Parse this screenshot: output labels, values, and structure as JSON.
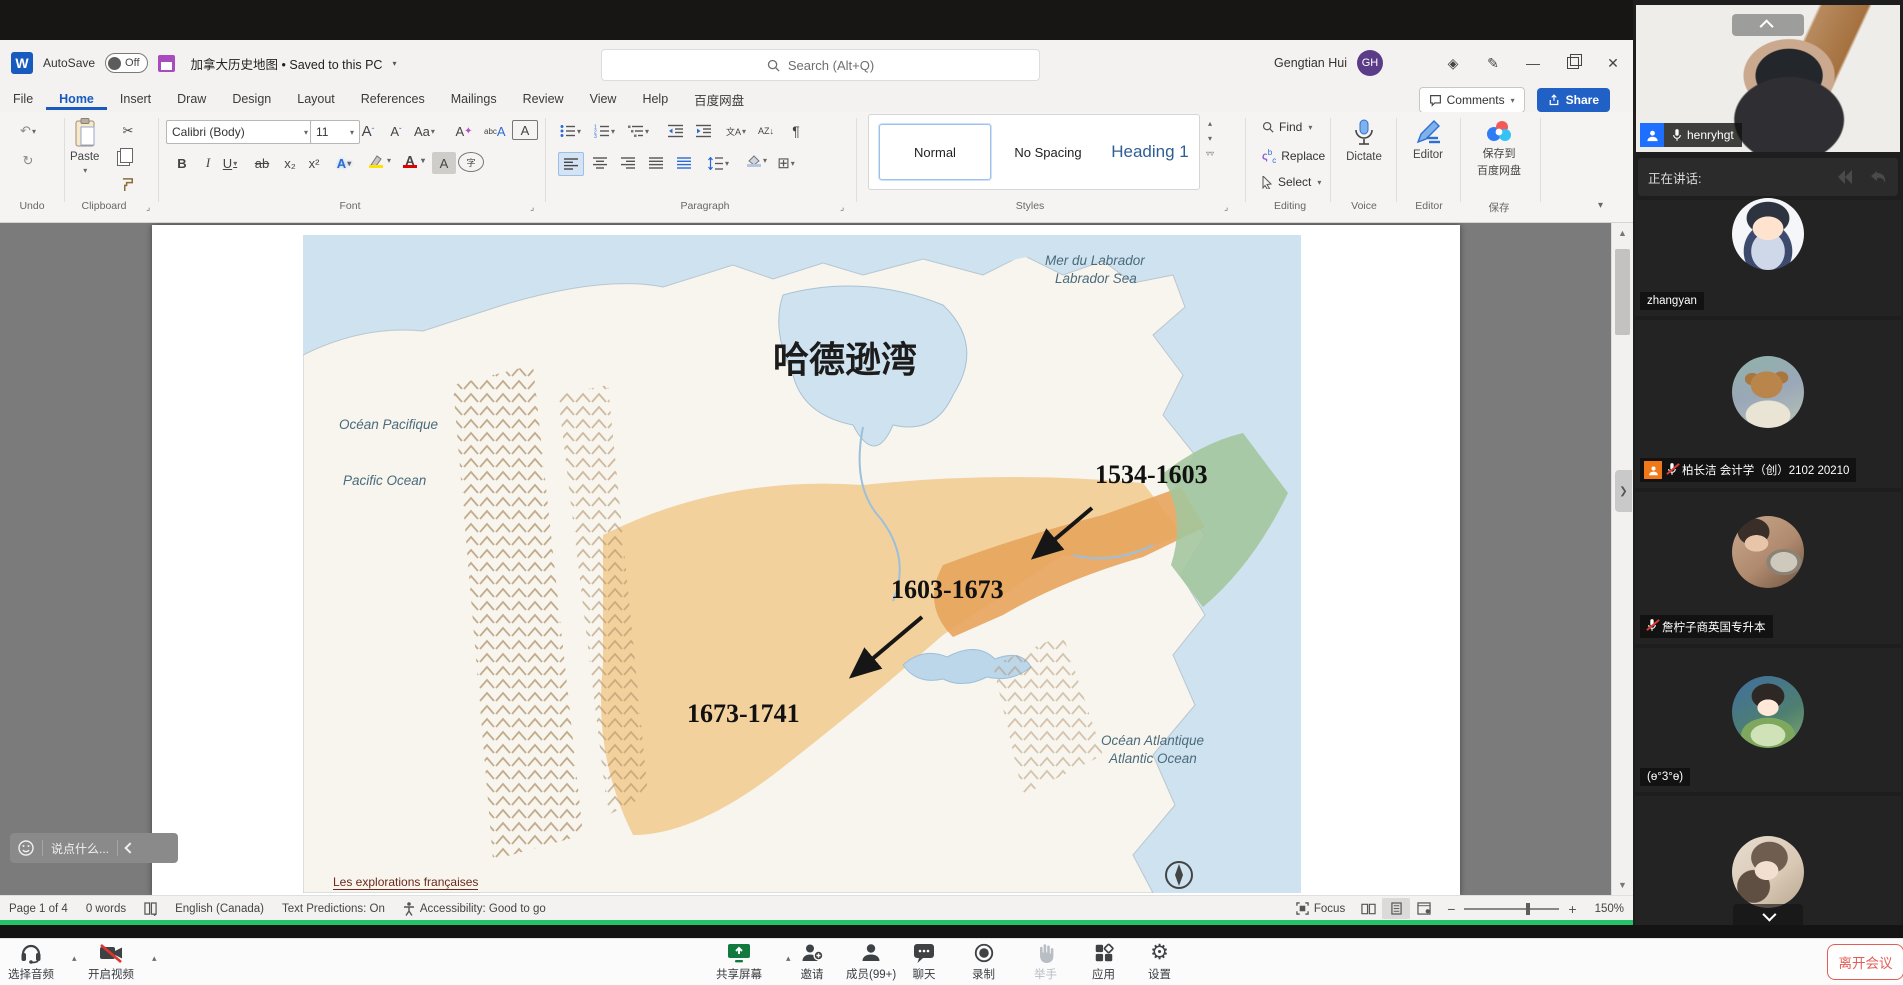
{
  "titlebar": {
    "autosave_label": "AutoSave",
    "autosave_state": "Off",
    "doc_title": "加拿大历史地图 • Saved to this PC",
    "search_placeholder": "Search (Alt+Q)",
    "user_name": "Gengtian Hui",
    "user_initials": "GH"
  },
  "tabs": [
    "File",
    "Home",
    "Insert",
    "Draw",
    "Design",
    "Layout",
    "References",
    "Mailings",
    "Review",
    "View",
    "Help",
    "百度网盘"
  ],
  "ribbon": {
    "comments_label": "Comments",
    "share_label": "Share",
    "undo_group_label": "Undo",
    "paste_label": "Paste",
    "clipboard_group_label": "Clipboard",
    "font_name": "Calibri (Body)",
    "font_size": "11",
    "font_group_label": "Font",
    "paragraph_group_label": "Paragraph",
    "style_normal": "Normal",
    "style_nospacing": "No Spacing",
    "style_heading1": "Heading 1",
    "styles_group_label": "Styles",
    "find_label": "Find",
    "replace_label": "Replace",
    "select_label": "Select",
    "editing_group_label": "Editing",
    "dictate_label": "Dictate",
    "voice_group_label": "Voice",
    "editor_label": "Editor",
    "editor_group_label": "Editor",
    "baidu_save_line1": "保存到",
    "baidu_save_line2": "百度网盘",
    "baidu_group_label": "保存",
    "glyphs": {
      "bold": "B",
      "italic": "I",
      "underline": "U",
      "strike": "ab",
      "subscript": "x₂",
      "superscript": "x²",
      "effects": "A",
      "fontcolor": "A",
      "shading_a": "A",
      "enclose": "字",
      "case": "Aa",
      "grow": "A",
      "shrink": "A",
      "clear": "A",
      "phonetic": "A",
      "charborder": "A",
      "pilcrow": "¶",
      "sort": "AZ↓",
      "asian": "文A"
    }
  },
  "map": {
    "hudson_bay": "哈德逊湾",
    "labrador_fr": "Mer du Labrador",
    "labrador_en": "Labrador Sea",
    "pacific_fr": "Océan Pacifique",
    "pacific_en": "Pacific Ocean",
    "atlantic_fr": "Océan Atlantique",
    "atlantic_en": "Atlantic Ocean",
    "period1": "1534-1603",
    "period2": "1603-1673",
    "period3": "1673-1741",
    "caption": "Les explorations françaises"
  },
  "chat_overlay": {
    "placeholder": "说点什么..."
  },
  "statusbar": {
    "page": "Page 1 of 4",
    "words": "0 words",
    "language": "English (Canada)",
    "predictions": "Text Predictions: On",
    "accessibility": "Accessibility: Good to go",
    "focus_label": "Focus",
    "zoom_level": "150%"
  },
  "meeting": {
    "self_name": "henryhgt",
    "speaking_label": "正在讲话:",
    "participants": [
      {
        "name": "zhangyan"
      },
      {
        "name": "柏长洁 会计学（创）2102 20210"
      },
      {
        "name": "詹柠子商英国专升本"
      },
      {
        "name": "(ө°3°ө)"
      },
      {
        "name": ""
      }
    ],
    "toolbar": {
      "audio": "选择音频",
      "video": "开启视频",
      "share": "共享屏幕",
      "invite": "邀请",
      "members": "成员(99+)",
      "chat": "聊天",
      "record": "录制",
      "hand": "举手",
      "apps": "应用",
      "settings": "设置"
    },
    "leave_label": "离开会议"
  }
}
